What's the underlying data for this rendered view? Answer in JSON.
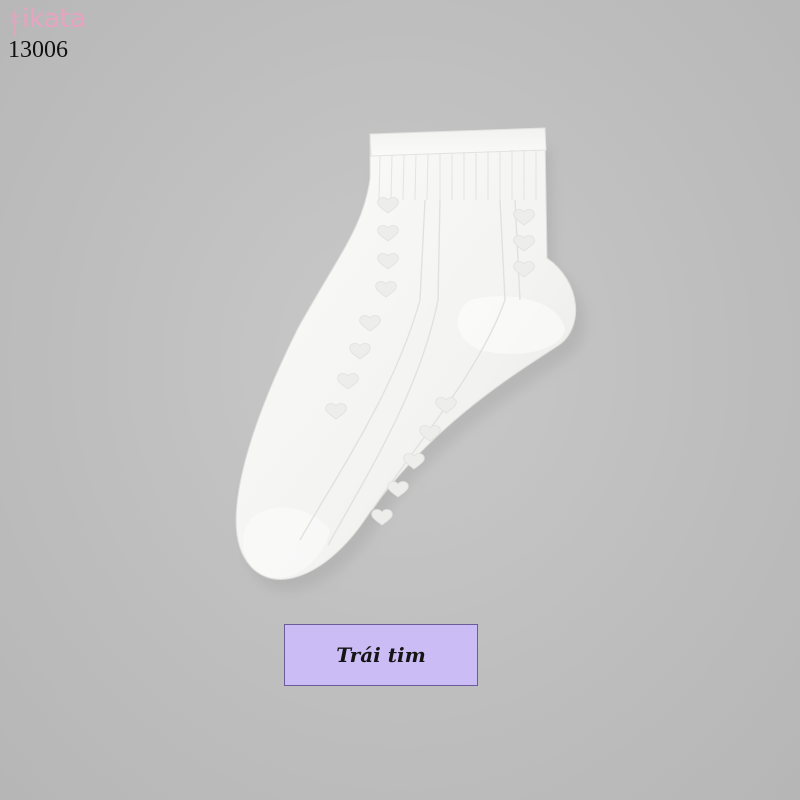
{
  "brand": {
    "name": "ikata",
    "color": "#e7a3c0"
  },
  "product": {
    "code": "13006",
    "variant_label": "Trái tim",
    "image": "white-ankle-sock"
  },
  "colors": {
    "background": "#bebebe",
    "label_fill": "#cbbcf5",
    "label_border": "#6a5c9a",
    "sock": "#f7f7f5"
  }
}
